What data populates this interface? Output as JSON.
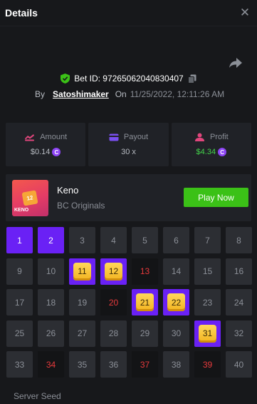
{
  "header": {
    "title": "Details"
  },
  "bet": {
    "id_label": "Bet ID: 97265062040830407",
    "by_label": "By",
    "user": "Satoshimaker",
    "on_label": "On",
    "date": "11/25/2022, 12:11:26 AM"
  },
  "stats": [
    {
      "label": "Amount",
      "value": "$0.14",
      "color": "#e0467c"
    },
    {
      "label": "Payout",
      "value": "30 x",
      "color": "#7a4ff0"
    },
    {
      "label": "Profit",
      "value": "$4.34",
      "color": "#e0467c"
    }
  ],
  "coin_symbol": "C",
  "game": {
    "thumb_number": "12",
    "thumb_label": "KENO",
    "name": "Keno",
    "provider": "BC Originals",
    "play_label": "Play Now"
  },
  "board": {
    "picked": [
      1,
      2
    ],
    "hits": [
      11,
      12,
      21,
      22,
      31
    ],
    "drawn_misses": [
      13,
      20,
      34,
      37,
      39
    ],
    "cells": [
      "1",
      "2",
      "3",
      "4",
      "5",
      "6",
      "7",
      "8",
      "9",
      "10",
      "11",
      "12",
      "13",
      "14",
      "15",
      "16",
      "17",
      "18",
      "19",
      "20",
      "21",
      "22",
      "23",
      "24",
      "25",
      "26",
      "27",
      "28",
      "29",
      "30",
      "31",
      "32",
      "33",
      "34",
      "35",
      "36",
      "37",
      "38",
      "39",
      "40"
    ]
  },
  "server_seed_label": "Server Seed",
  "colors": {
    "accent_purple": "#6a21f5",
    "play_green": "#3bc117",
    "profit_green": "#43d34b",
    "miss_red": "#e73a3c"
  }
}
